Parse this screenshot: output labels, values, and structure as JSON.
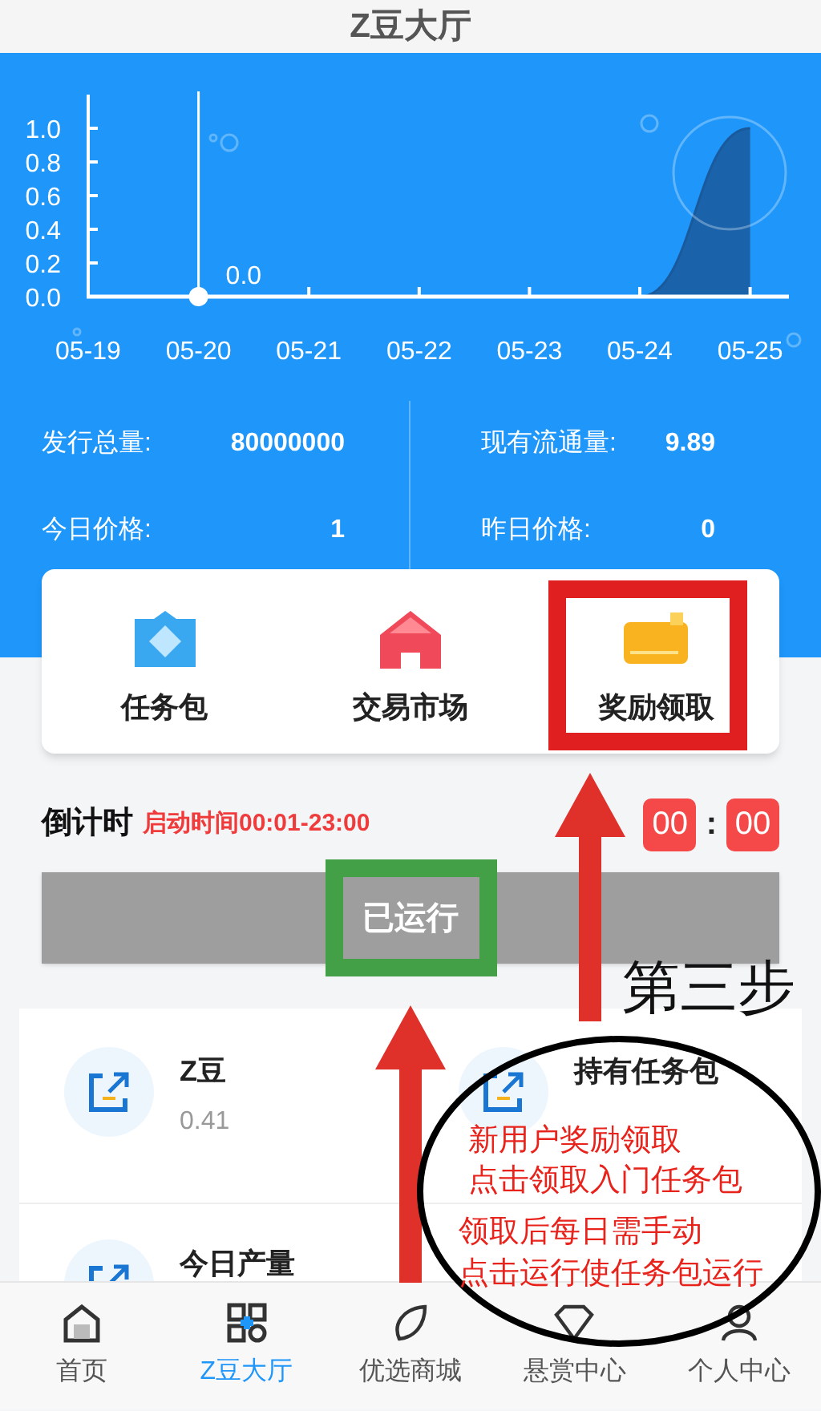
{
  "header": {
    "title": "Z豆大厅"
  },
  "chart": {
    "chart_data": {
      "type": "area",
      "categories": [
        "05-19",
        "05-20",
        "05-21",
        "05-22",
        "05-23",
        "05-24",
        "05-25"
      ],
      "series": [
        {
          "color": "#1a5a9c",
          "values": [
            null,
            0,
            0,
            0,
            0,
            0,
            1
          ]
        }
      ],
      "ylim": [
        0,
        1.2
      ],
      "yticks": [
        {
          "value": 0,
          "label": "0.0"
        },
        {
          "value": 0.2,
          "label": "0.2"
        },
        {
          "value": 0.4,
          "label": "0.4"
        },
        {
          "value": 0.6,
          "label": "0.6"
        },
        {
          "value": 0.8,
          "label": "0.8"
        },
        {
          "value": 1,
          "label": "1.0"
        }
      ],
      "annotations": [
        {
          "x": "05-20",
          "y": 0,
          "text": "0.0"
        }
      ]
    }
  },
  "stats": [
    {
      "label": "发行总量:",
      "value": "80000000"
    },
    {
      "label": "现有流通量:",
      "value": "9.89"
    },
    {
      "label": "今日价格:",
      "value": "1"
    },
    {
      "label": "昨日价格:",
      "value": "0"
    }
  ],
  "shortcuts": [
    {
      "label": "任务包",
      "kind": "gem"
    },
    {
      "label": "交易市场",
      "kind": "house"
    },
    {
      "label": "奖励领取",
      "kind": "wallet"
    }
  ],
  "countdown": {
    "title": "倒计时",
    "window": "启动时间00:01-23:00",
    "hours": "00",
    "separator": ":",
    "minutes": "00"
  },
  "run_button": {
    "label": "已运行",
    "disabled": true
  },
  "assets": [
    {
      "name": "Z豆",
      "value": "0.41"
    },
    {
      "name": "持有任务包"
    },
    {
      "name": "今日产量"
    }
  ],
  "tabs": [
    {
      "label": "首页",
      "kind": "home",
      "selected": false
    },
    {
      "label": "Z豆大厅",
      "kind": "grid",
      "selected": true
    },
    {
      "label": "优选商城",
      "kind": "leaf",
      "selected": false
    },
    {
      "label": "悬赏中心",
      "kind": "gem",
      "selected": false
    },
    {
      "label": "个人中心",
      "kind": "user",
      "selected": false
    }
  ],
  "annotations": {
    "highlights": [
      {
        "color": "#e02020"
      },
      {
        "color": "#43a047"
      }
    ],
    "step_label": "第三步",
    "notes": [
      "新用户奖励领取",
      "点击领取入门任务包",
      "领取后每日需手动",
      "点击运行使任务包运行"
    ]
  }
}
